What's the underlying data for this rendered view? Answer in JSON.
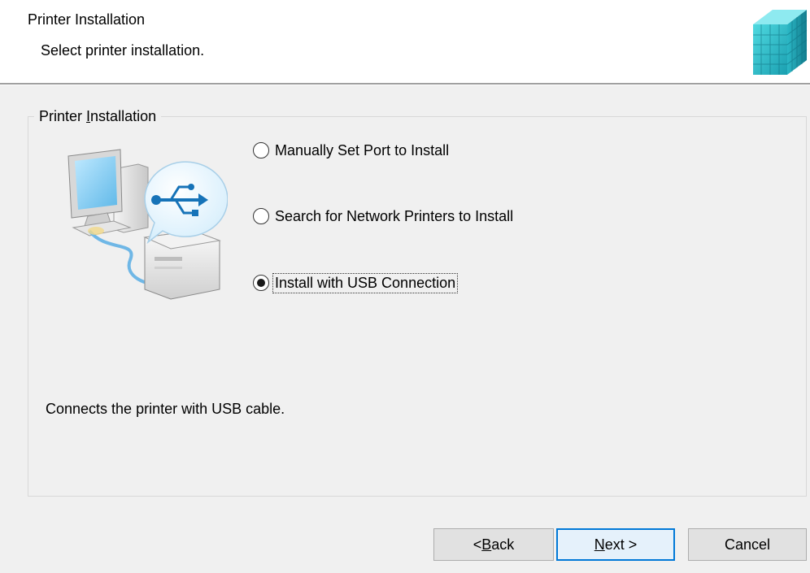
{
  "header": {
    "title": "Printer Installation",
    "subtitle": "Select printer installation.",
    "logo_icon": "installer-cube-icon"
  },
  "group": {
    "legend_pre": "Printer ",
    "legend_mnemonic": "I",
    "legend_post": "nstallation"
  },
  "illustration_icon": "computer-usb-printer-icon",
  "options": [
    {
      "label": "Manually Set Port to Install",
      "selected": false
    },
    {
      "label": "Search for Network Printers to Install",
      "selected": false
    },
    {
      "label": "Install with USB Connection",
      "selected": true
    }
  ],
  "description": "Connects the printer with USB cable.",
  "buttons": {
    "back_pre": "< ",
    "back_mnemonic": "B",
    "back_post": "ack",
    "next_mnemonic": "N",
    "next_post": "ext >",
    "cancel": "Cancel"
  },
  "colors": {
    "accent": "#0078d7",
    "window_bg": "#f0f0f0",
    "header_bg": "#ffffff"
  }
}
